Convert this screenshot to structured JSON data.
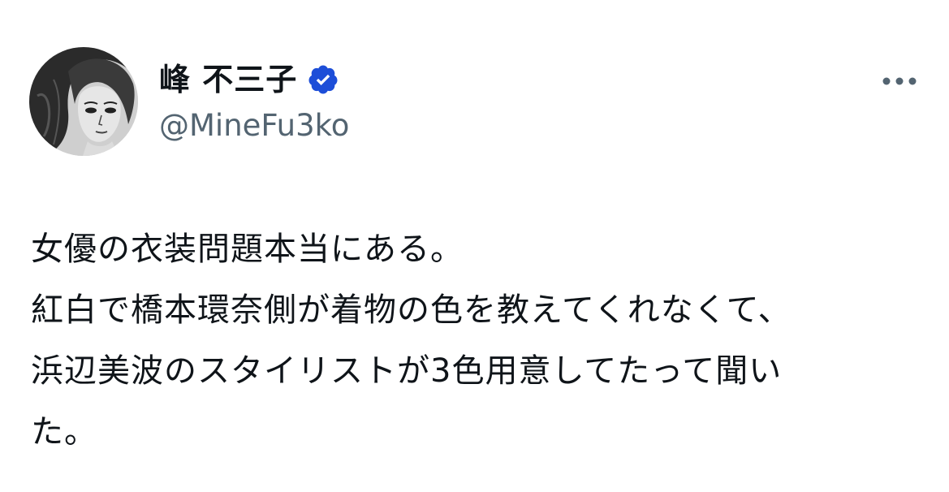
{
  "author": {
    "display_name": "峰 不三子",
    "handle": "@MineFu3ko",
    "verified": true,
    "verified_badge_color": "#1d4ed8",
    "avatar_icon": "anime-woman-portrait"
  },
  "menu": {
    "icon": "more-horizontal-icon"
  },
  "tweet": {
    "lines": [
      "女優の衣装問題本当にある。",
      "紅白で橋本環奈側が着物の色を教えてくれなくて、",
      "浜辺美波のスタイリストが3色用意してたって聞い",
      "た。"
    ]
  },
  "colors": {
    "text_primary": "#0f1419",
    "text_secondary": "#536471",
    "background": "#ffffff"
  }
}
